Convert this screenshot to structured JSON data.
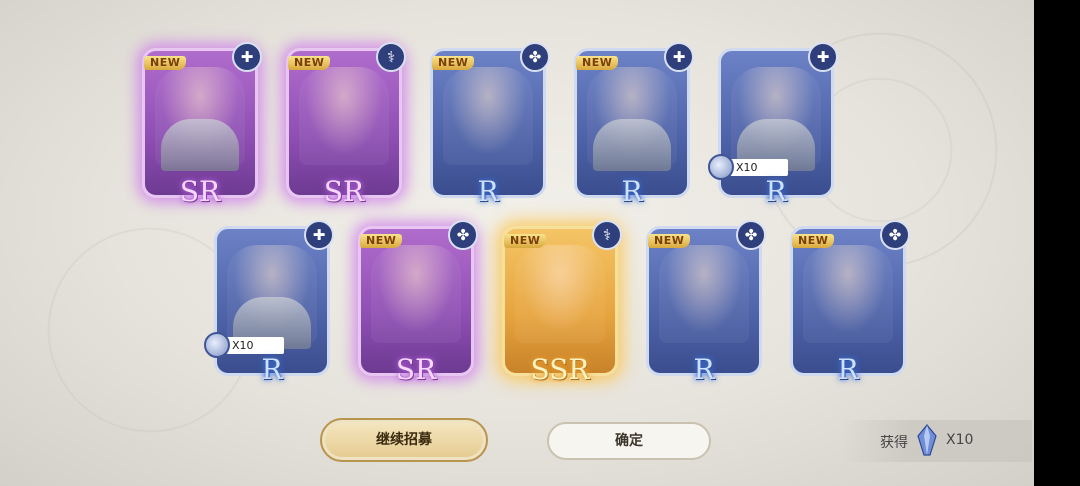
{
  "cards": [
    {
      "rarity": "SR",
      "is_new": true,
      "class_icon": "shield-icon",
      "glyph": "✚",
      "duplicate": null
    },
    {
      "rarity": "SR",
      "is_new": true,
      "class_icon": "staff-icon",
      "glyph": "⚕",
      "duplicate": null
    },
    {
      "rarity": "R",
      "is_new": true,
      "class_icon": "magic-icon",
      "glyph": "✤",
      "duplicate": null
    },
    {
      "rarity": "R",
      "is_new": true,
      "class_icon": "shield-icon",
      "glyph": "✚",
      "duplicate": null
    },
    {
      "rarity": "R",
      "is_new": false,
      "class_icon": "shield-icon",
      "glyph": "✚",
      "duplicate": "X10"
    },
    {
      "rarity": "R",
      "is_new": false,
      "class_icon": "shield-icon",
      "glyph": "✚",
      "duplicate": "X10"
    },
    {
      "rarity": "SR",
      "is_new": true,
      "class_icon": "magic-icon",
      "glyph": "✤",
      "duplicate": null
    },
    {
      "rarity": "SSR",
      "is_new": true,
      "class_icon": "staff-icon",
      "glyph": "⚕",
      "duplicate": null
    },
    {
      "rarity": "R",
      "is_new": true,
      "class_icon": "magic-icon",
      "glyph": "✤",
      "duplicate": null
    },
    {
      "rarity": "R",
      "is_new": true,
      "class_icon": "magic-icon",
      "glyph": "✤",
      "duplicate": null
    }
  ],
  "new_label": "NEW",
  "buttons": {
    "continue": "继续招募",
    "confirm": "确定"
  },
  "reward": {
    "label": "获得",
    "quantity": "X10",
    "icon": "crystal-icon"
  },
  "colors": {
    "r_frame": "#4e63a8",
    "sr_frame": "#8e4fb3",
    "ssr_frame": "#e7a43e",
    "new_badge": "#d9a93d"
  }
}
